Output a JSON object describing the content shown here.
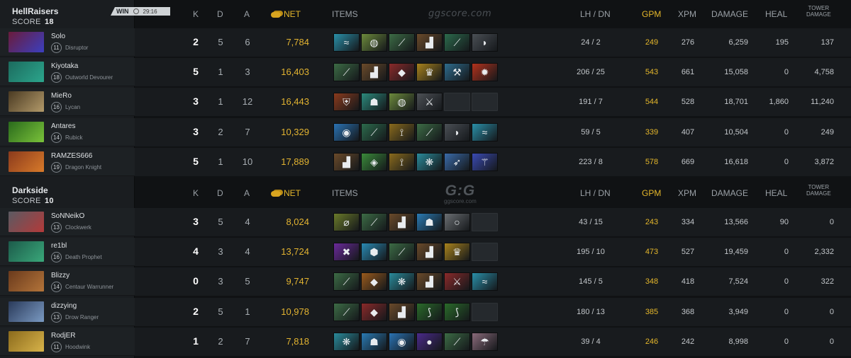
{
  "watermark": {
    "site": "ggscore.com",
    "logo_big": "G:G",
    "logo_small": "ggscore.com"
  },
  "columns": {
    "k": "K",
    "d": "D",
    "a": "A",
    "net": "NET",
    "items": "ITEMS",
    "lhdn": "LH  /  DN",
    "gpm": "GPM",
    "xpm": "XPM",
    "damage": "DAMAGE",
    "heal": "HEAL",
    "tower_damage_1": "TOWER",
    "tower_damage_2": "DAMAGE"
  },
  "colors": {
    "gold": "#e5b72b",
    "win_badge": "#cfd3d6"
  },
  "teams": [
    {
      "name": "HellRaisers",
      "score_label": "SCORE",
      "score": "18",
      "result": "WIN",
      "duration": "29:16",
      "players": [
        {
          "name": "Solo",
          "level": "11",
          "hero": "Disruptor",
          "k": "2",
          "d": "5",
          "a": "6",
          "net": "7,784",
          "lh_dn": "24  /  2",
          "gpm": "249",
          "xpm": "276",
          "damage": "6,259",
          "heal": "195",
          "tower_damage": "137",
          "portrait": [
            "#6a1b3b",
            "#3b3fbf"
          ],
          "items": [
            {
              "icon": "wind-lace-icon",
              "c": "#2a8fa8"
            },
            {
              "icon": "drum-icon",
              "c": "#6c8a3c"
            },
            {
              "icon": "staff-icon",
              "c": "#3c6b45"
            },
            {
              "icon": "boots-icon",
              "c": "#6a4a2a"
            },
            {
              "icon": "staff-green-icon",
              "c": "#2c6a4c"
            },
            {
              "icon": "blade-icon",
              "c": "#4a4f55"
            }
          ]
        },
        {
          "name": "Kiyotaka",
          "level": "18",
          "hero": "Outworld Devourer",
          "k": "5",
          "d": "1",
          "a": "3",
          "net": "16,403",
          "lh_dn": "206  /  25",
          "gpm": "543",
          "xpm": "661",
          "damage": "15,058",
          "heal": "0",
          "tower_damage": "4,758",
          "portrait": [
            "#1c6b5e",
            "#2ca58c"
          ],
          "items": [
            {
              "icon": "staff-icon",
              "c": "#3c6b45"
            },
            {
              "icon": "boots-icon",
              "c": "#6a4a2a"
            },
            {
              "icon": "mask-icon",
              "c": "#8a2a2a"
            },
            {
              "icon": "helm-icon",
              "c": "#a8821c"
            },
            {
              "icon": "scythe-icon",
              "c": "#2e6b8c"
            },
            {
              "icon": "orb-fire-icon",
              "c": "#b3321c"
            }
          ]
        },
        {
          "name": "MieRo",
          "level": "16",
          "hero": "Lycan",
          "k": "3",
          "d": "1",
          "a": "12",
          "net": "16,443",
          "lh_dn": "191  /  7",
          "gpm": "544",
          "xpm": "528",
          "damage": "18,701",
          "heal": "1,860",
          "tower_damage": "11,240",
          "portrait": [
            "#4a3a22",
            "#b39a6a"
          ],
          "items": [
            {
              "icon": "armor-icon",
              "c": "#8a3a1c"
            },
            {
              "icon": "skull-icon",
              "c": "#2c8a7c"
            },
            {
              "icon": "drum-icon",
              "c": "#6c8a3c"
            },
            {
              "icon": "axe-icon",
              "c": "#4c5055"
            },
            {
              "icon": "empty",
              "c": ""
            },
            {
              "icon": "empty",
              "c": ""
            }
          ]
        },
        {
          "name": "Antares",
          "level": "14",
          "hero": "Rubick",
          "k": "3",
          "d": "2",
          "a": "7",
          "net": "10,329",
          "lh_dn": "59  /  5",
          "gpm": "339",
          "xpm": "407",
          "damage": "10,504",
          "heal": "0",
          "tower_damage": "249",
          "portrait": [
            "#2a6a1c",
            "#7ac23a"
          ],
          "items": [
            {
              "icon": "orb-blue-icon",
              "c": "#2a72b3"
            },
            {
              "icon": "staff-green-icon",
              "c": "#2c6a4c"
            },
            {
              "icon": "claw-icon",
              "c": "#8a6a1c"
            },
            {
              "icon": "staff-icon",
              "c": "#3c6b45"
            },
            {
              "icon": "blade-icon",
              "c": "#4a4f55"
            },
            {
              "icon": "wind-lace-icon",
              "c": "#2a8fa8"
            }
          ]
        },
        {
          "name": "RAMZES666",
          "level": "19",
          "hero": "Dragon Knight",
          "k": "5",
          "d": "1",
          "a": "10",
          "net": "17,889",
          "lh_dn": "223  /  8",
          "gpm": "578",
          "xpm": "669",
          "damage": "16,618",
          "heal": "0",
          "tower_damage": "3,872",
          "portrait": [
            "#8a3a1c",
            "#d87a2a"
          ],
          "items": [
            {
              "icon": "boots-icon",
              "c": "#6a4a2a"
            },
            {
              "icon": "gem-green-icon",
              "c": "#3a8a3a"
            },
            {
              "icon": "claw-icon",
              "c": "#8a6a1c"
            },
            {
              "icon": "fan-icon",
              "c": "#2a8a9a"
            },
            {
              "icon": "spear-icon",
              "c": "#3a6aa8"
            },
            {
              "icon": "scepter-icon",
              "c": "#3a4ab3"
            }
          ]
        }
      ]
    },
    {
      "name": "Darkside",
      "score_label": "SCORE",
      "score": "10",
      "players": [
        {
          "name": "SoNNeikO",
          "level": "13",
          "hero": "Clockwerk",
          "k": "3",
          "d": "5",
          "a": "4",
          "net": "8,024",
          "lh_dn": "43  /  15",
          "gpm": "243",
          "xpm": "334",
          "damage": "13,566",
          "heal": "90",
          "tower_damage": "0",
          "portrait": [
            "#5a5a62",
            "#b33a3a"
          ],
          "items": [
            {
              "icon": "ring-icon",
              "c": "#6a7a2a"
            },
            {
              "icon": "staff-icon",
              "c": "#3c6b45"
            },
            {
              "icon": "boots-icon",
              "c": "#6a4a2a"
            },
            {
              "icon": "skull-blue-icon",
              "c": "#2a7ab3"
            },
            {
              "icon": "ring-silver-icon",
              "c": "#6a6e72"
            },
            {
              "icon": "empty",
              "c": ""
            }
          ]
        },
        {
          "name": "re1bl",
          "level": "16",
          "hero": "Death Prophet",
          "k": "4",
          "d": "3",
          "a": "4",
          "net": "13,724",
          "lh_dn": "195  /  10",
          "gpm": "473",
          "xpm": "527",
          "damage": "19,459",
          "heal": "0",
          "tower_damage": "2,332",
          "portrait": [
            "#1c5a4a",
            "#3aa87a"
          ],
          "items": [
            {
              "icon": "cross-icon",
              "c": "#6a2a9a"
            },
            {
              "icon": "crystal-icon",
              "c": "#2a8ab3"
            },
            {
              "icon": "staff-icon",
              "c": "#3c6b45"
            },
            {
              "icon": "boots-icon",
              "c": "#6a4a2a"
            },
            {
              "icon": "helm-icon",
              "c": "#a8821c"
            },
            {
              "icon": "empty",
              "c": ""
            }
          ]
        },
        {
          "name": "Blizzy",
          "level": "14",
          "hero": "Centaur Warrunner",
          "k": "0",
          "d": "3",
          "a": "5",
          "net": "9,747",
          "lh_dn": "145  /  5",
          "gpm": "348",
          "xpm": "418",
          "damage": "7,524",
          "heal": "0",
          "tower_damage": "322",
          "portrait": [
            "#6a3a1c",
            "#b3743a"
          ],
          "items": [
            {
              "icon": "staff-icon",
              "c": "#3c6b45"
            },
            {
              "icon": "mask-gold-icon",
              "c": "#9a5a1c"
            },
            {
              "icon": "fan-icon",
              "c": "#2a8a9a"
            },
            {
              "icon": "boots-icon",
              "c": "#6a4a2a"
            },
            {
              "icon": "axe-red-icon",
              "c": "#8a2a2a"
            },
            {
              "icon": "wind-lace-icon",
              "c": "#2a8fa8"
            }
          ]
        },
        {
          "name": "dizzying",
          "level": "13",
          "hero": "Drow Ranger",
          "k": "2",
          "d": "5",
          "a": "1",
          "net": "10,978",
          "lh_dn": "180  /  13",
          "gpm": "385",
          "xpm": "368",
          "damage": "3,949",
          "heal": "0",
          "tower_damage": "0",
          "portrait": [
            "#2a3a5a",
            "#7a9ac2"
          ],
          "items": [
            {
              "icon": "staff-icon",
              "c": "#3c6b45"
            },
            {
              "icon": "mask-icon",
              "c": "#8a2a2a"
            },
            {
              "icon": "boots-icon",
              "c": "#6a4a2a"
            },
            {
              "icon": "bracer-icon",
              "c": "#2a6a2a"
            },
            {
              "icon": "bracer-icon",
              "c": "#2a6a2a"
            },
            {
              "icon": "empty",
              "c": ""
            }
          ]
        },
        {
          "name": "RodjER",
          "level": "11",
          "hero": "Hoodwink",
          "k": "1",
          "d": "2",
          "a": "7",
          "net": "7,818",
          "lh_dn": "39  /  4",
          "gpm": "246",
          "xpm": "242",
          "damage": "8,998",
          "heal": "0",
          "tower_damage": "0",
          "portrait": [
            "#8a6a1c",
            "#d8b34a"
          ],
          "items": [
            {
              "icon": "fan-icon",
              "c": "#2a8a9a"
            },
            {
              "icon": "skull-blue-icon",
              "c": "#2a7ab3"
            },
            {
              "icon": "orb-blue-icon",
              "c": "#2a72b3"
            },
            {
              "icon": "orb-purple-icon",
              "c": "#4a2a8a"
            },
            {
              "icon": "staff-icon",
              "c": "#3c6b45"
            },
            {
              "icon": "cloak-icon",
              "c": "#8a6a7a"
            }
          ]
        }
      ]
    }
  ]
}
